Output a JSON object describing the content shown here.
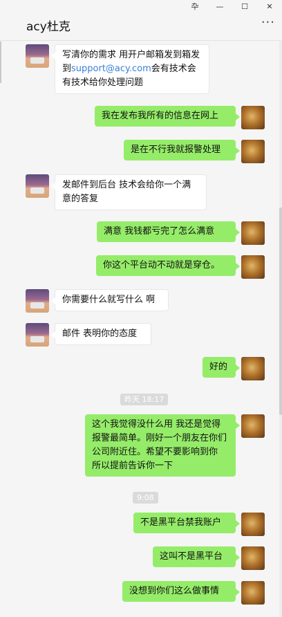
{
  "window": {
    "controls": [
      "卆",
      "—",
      "☐",
      "✕"
    ]
  },
  "header": {
    "title": "acy杜克",
    "more": "···"
  },
  "messages": [
    {
      "from": "peer",
      "text_a": "写清你的需求  用开户邮箱发到箱发到",
      "link": "support@acy.com",
      "text_b": "会有技术会有技术给你处理问题"
    },
    {
      "from": "self",
      "text": "我在发布我所有的信息在网上"
    },
    {
      "from": "self",
      "text": "是在不行我就报警处理"
    },
    {
      "from": "peer",
      "text": "发邮件到后台 技术会给你一个满意的答复"
    },
    {
      "from": "self",
      "text": "满意   我钱都亏完了怎么满意"
    },
    {
      "from": "self",
      "text": "你这个平台动不动就是穿仓。"
    },
    {
      "from": "peer",
      "text": "你需要什么就写什么 啊"
    },
    {
      "from": "peer",
      "text": "邮件 表明你的态度"
    },
    {
      "from": "self",
      "text": "好的"
    },
    {
      "from": "self",
      "text": "这个我觉得没什么用   我还是觉得报警最简单。刚好一个朋友在你们公司附近住。希望不要影响到你  所以提前告诉你一下"
    },
    {
      "from": "self",
      "text": "不是黑平台禁我账户"
    },
    {
      "from": "self",
      "text": "这叫不是黑平台"
    },
    {
      "from": "self",
      "text": "没想到你们这么做事情"
    }
  ],
  "timestamps": [
    "昨天 18:17",
    "9:08"
  ]
}
